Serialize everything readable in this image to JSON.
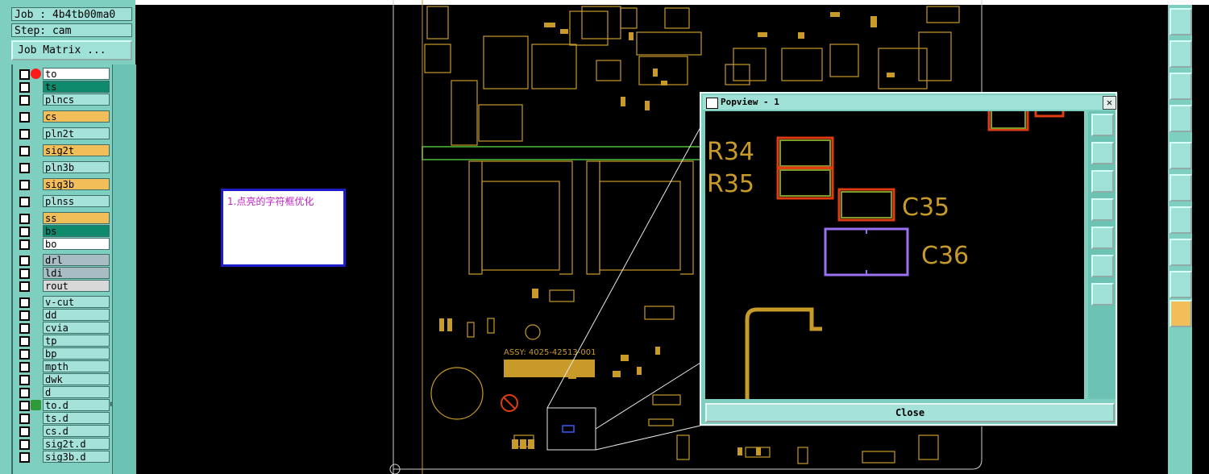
{
  "job": {
    "label": "Job : 4b4tb00ma0",
    "step_label": "Step: cam",
    "matrix_button": "Job Matrix ..."
  },
  "layers": [
    {
      "name": "to",
      "style": "white",
      "marker": "red-dot"
    },
    {
      "name": "ts",
      "style": "green"
    },
    {
      "name": "plncs",
      "style": "cyan"
    },
    {
      "name": "cs",
      "style": "orange"
    },
    {
      "name": "pln2t",
      "style": "cyan"
    },
    {
      "name": "sig2t",
      "style": "orange"
    },
    {
      "name": "pln3b",
      "style": "cyan"
    },
    {
      "name": "sig3b",
      "style": "orange"
    },
    {
      "name": "plnss",
      "style": "cyan"
    },
    {
      "name": "ss",
      "style": "orange"
    },
    {
      "name": "bs",
      "style": "green"
    },
    {
      "name": "bo",
      "style": "white"
    },
    {
      "name": "drl",
      "style": "gray"
    },
    {
      "name": "ldi",
      "style": "gray"
    },
    {
      "name": "rout",
      "style": "light"
    },
    {
      "name": "v-cut",
      "style": "cyan"
    },
    {
      "name": "dd",
      "style": "cyan"
    },
    {
      "name": "cvia",
      "style": "cyan"
    },
    {
      "name": "tp",
      "style": "cyan"
    },
    {
      "name": "bp",
      "style": "cyan"
    },
    {
      "name": "mpth",
      "style": "cyan"
    },
    {
      "name": "dwk",
      "style": "cyan"
    },
    {
      "name": "d",
      "style": "cyan"
    },
    {
      "name": "to.d",
      "style": "cyan",
      "marker": "green-icon",
      "extra": "⊞"
    },
    {
      "name": "ts.d",
      "style": "cyan"
    },
    {
      "name": "cs.d",
      "style": "cyan"
    },
    {
      "name": "sig2t.d",
      "style": "cyan"
    },
    {
      "name": "sig3b.d",
      "style": "cyan"
    }
  ],
  "note": {
    "text": "1.点亮的字符框优化"
  },
  "pcb": {
    "assy_label": "ASSY: 4025-42513-001",
    "silk_labels": [
      "R34",
      "R35",
      "C35",
      "C36"
    ]
  },
  "popview": {
    "title": "Popview - 1",
    "close_x": "✕",
    "close_button": "Close",
    "components": [
      {
        "ref": "R34"
      },
      {
        "ref": "R35"
      },
      {
        "ref": "C35"
      },
      {
        "ref": "C36"
      }
    ]
  },
  "colors": {
    "panel": "#7fcfc1",
    "silkscreen": "#c89a2a",
    "pad_outline_red": "#e03c12",
    "pad_outline_green": "#7a9a2a",
    "highlight_purple": "#9a72f0",
    "note_border": "#1c1cc8",
    "note_text": "#c020c0"
  }
}
